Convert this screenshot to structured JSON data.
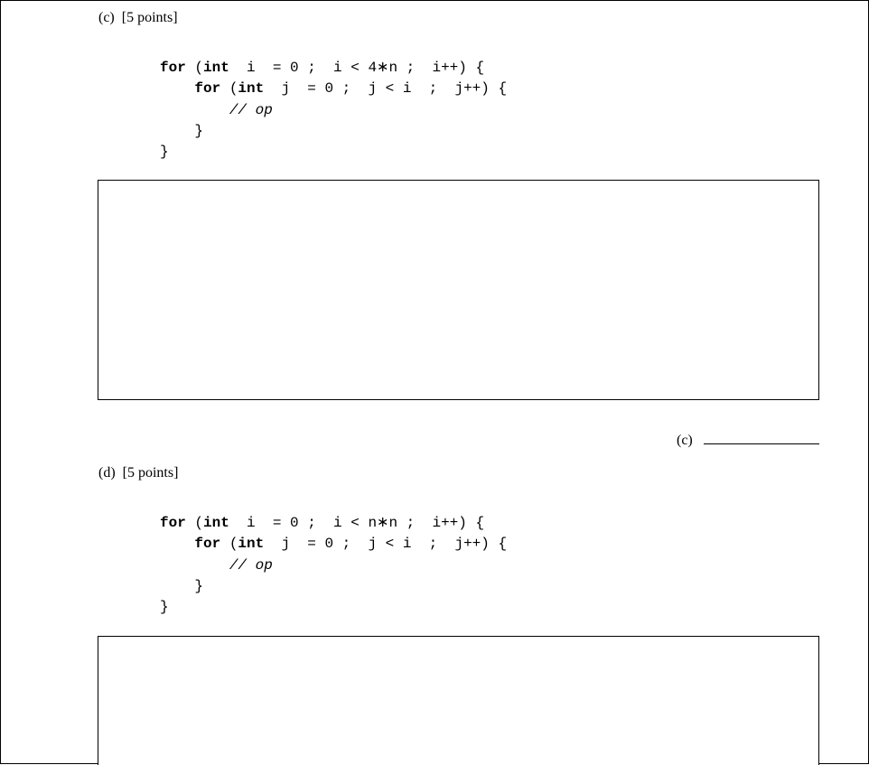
{
  "part_c": {
    "label": "(c)",
    "points": "[5 points]",
    "code": {
      "l1a": "for",
      "l1b": " (",
      "l1c": "int",
      "l1d": "  i  = 0 ;  i < 4∗n ;  i++) {",
      "l2a": "for",
      "l2b": " (",
      "l2c": "int",
      "l2d": "  j  = 0 ;  j < i  ;  j++) {",
      "l3": "// op",
      "l4": "}",
      "l5": "}"
    },
    "answer_label": "(c)"
  },
  "part_d": {
    "label": "(d)",
    "points": "[5 points]",
    "code": {
      "l1a": "for",
      "l1b": " (",
      "l1c": "int",
      "l1d": "  i  = 0 ;  i < n∗n ;  i++) {",
      "l2a": "for",
      "l2b": " (",
      "l2c": "int",
      "l2d": "  j  = 0 ;  j < i  ;  j++) {",
      "l3": "// op",
      "l4": "}",
      "l5": "}"
    }
  }
}
